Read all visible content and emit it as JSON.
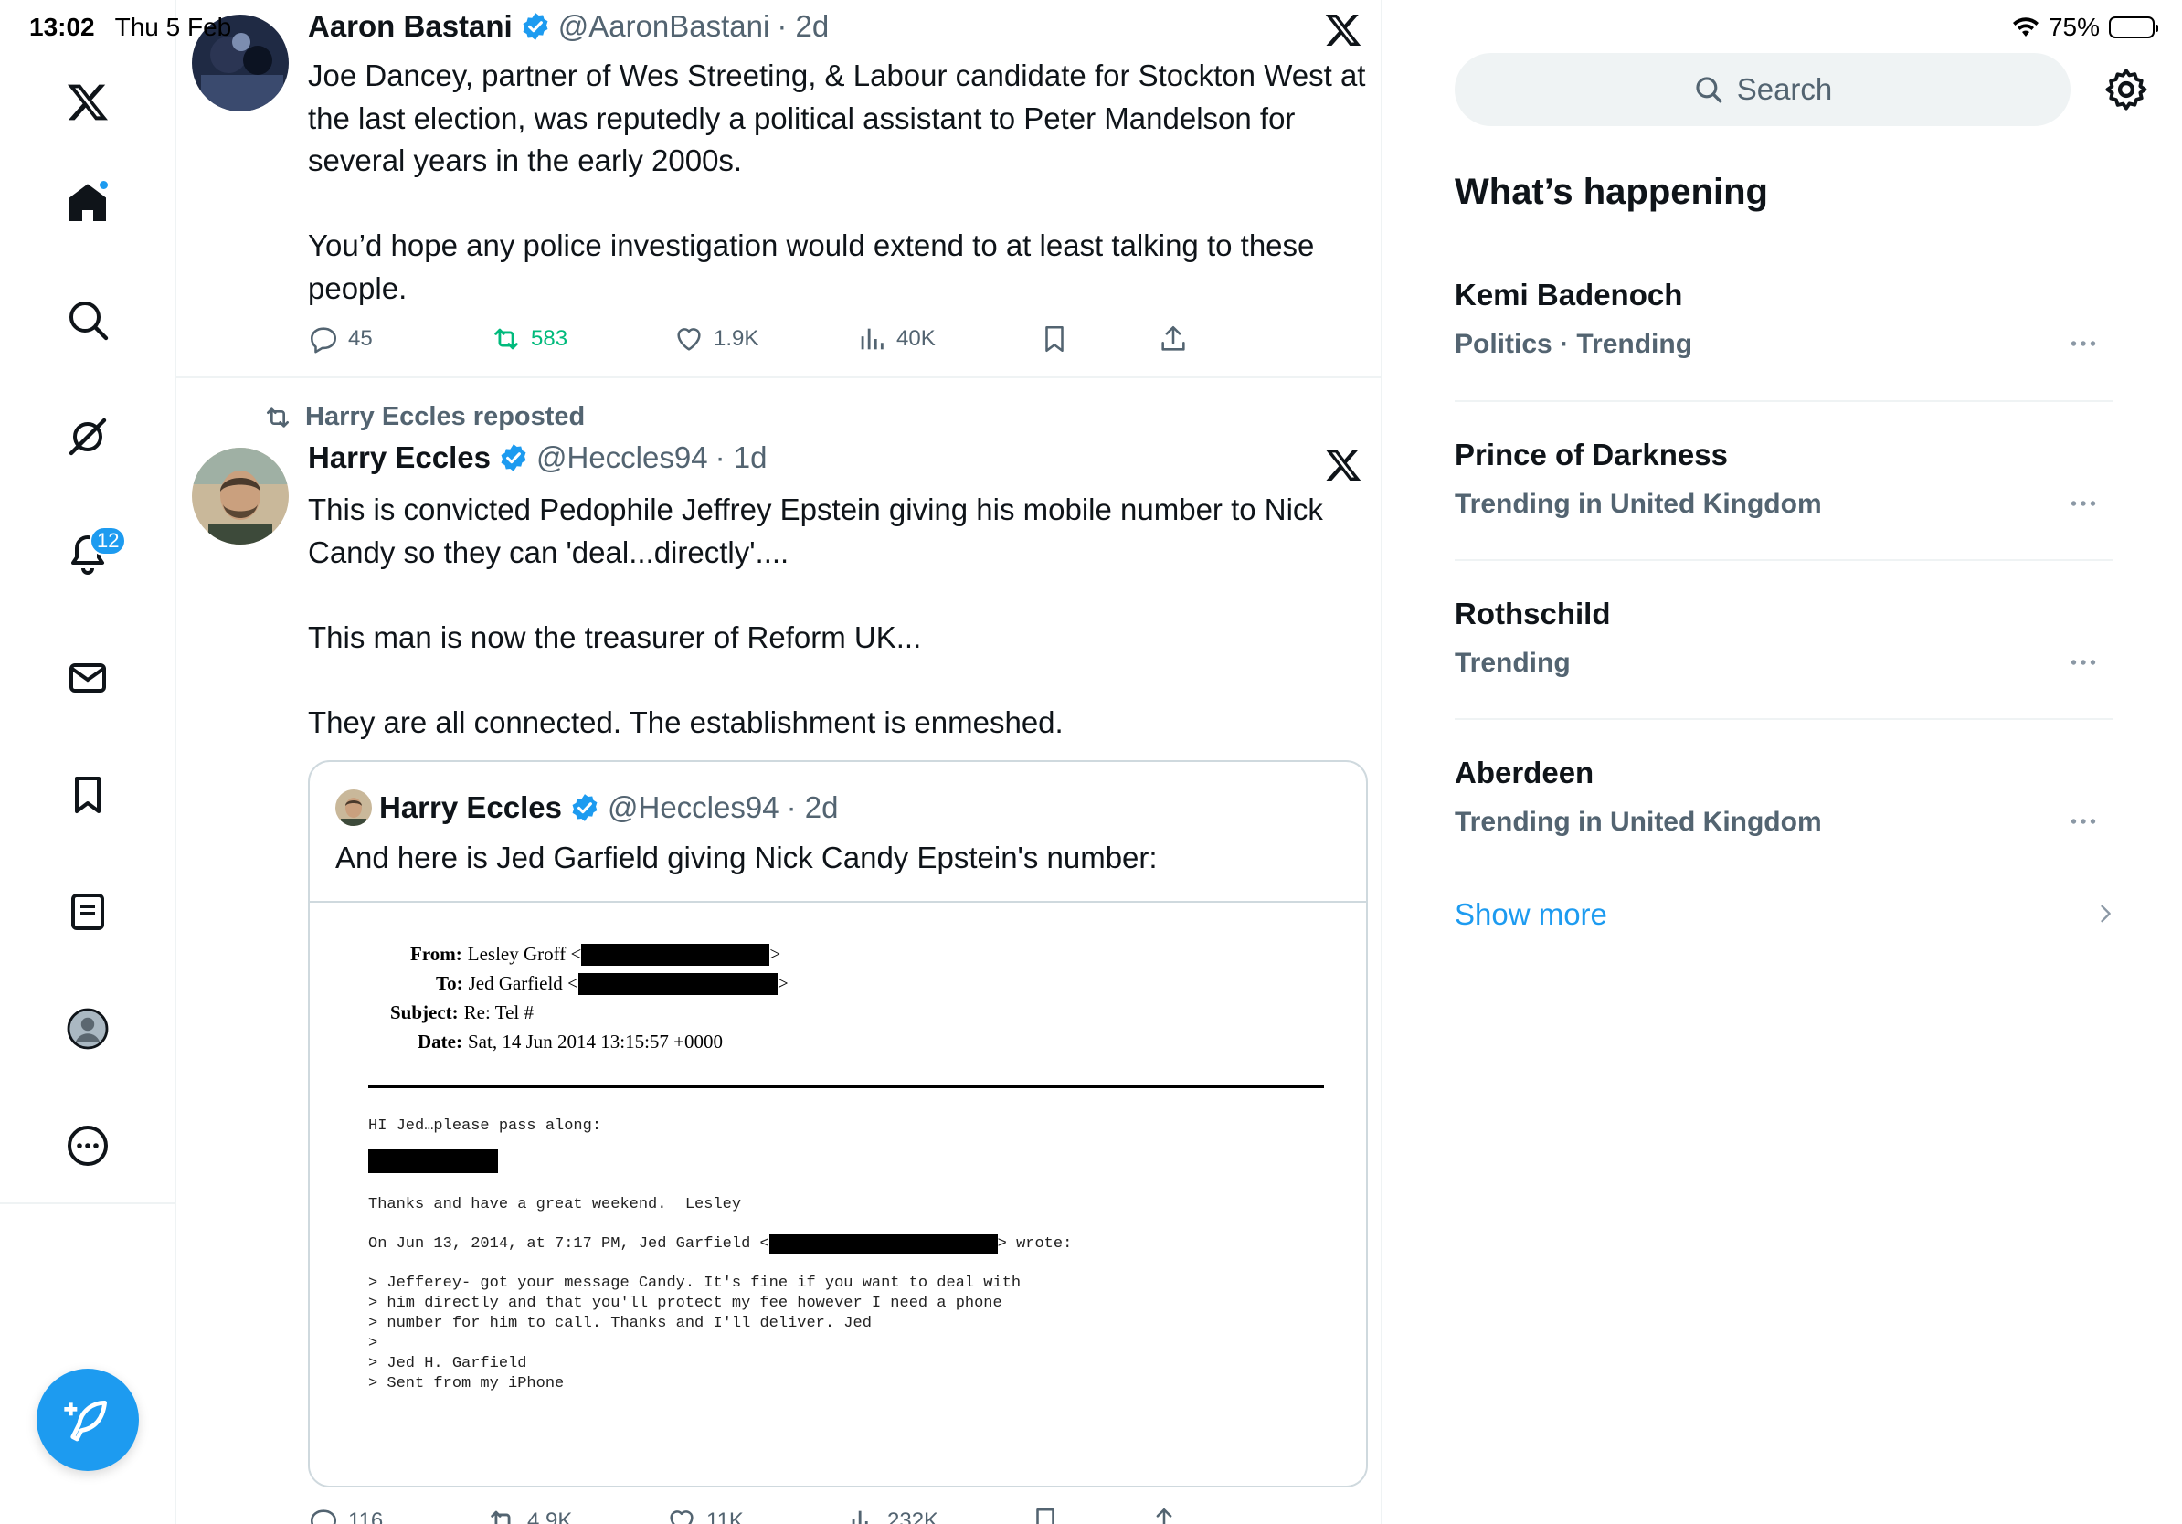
{
  "status_bar": {
    "time": "13:02",
    "date": "Thu 5 Feb",
    "battery": "75%"
  },
  "nav": {
    "items": [
      "x-logo-icon",
      "home-icon",
      "search-icon",
      "grok-icon",
      "notifications-icon",
      "messages-icon",
      "bookmarks-icon",
      "lists-icon",
      "profile-icon",
      "more-icon"
    ],
    "notifications_badge": "12"
  },
  "feed": {
    "tweet1": {
      "name": "Aaron Bastani",
      "handle": "@AaronBastani",
      "time": "· 2d",
      "text": "Joe Dancey, partner of Wes Streeting, & Labour candidate for Stockton West at the last election, was reputedly a political assistant to Peter Mandelson for several years in the early 2000s.\n\nYou’d hope any police investigation would extend to at least talking to these people.",
      "replies": "45",
      "reposts": "583",
      "likes": "1.9K",
      "views": "40K"
    },
    "tweet2": {
      "reposted_by": "Harry Eccles reposted",
      "name": "Harry Eccles",
      "handle": "@Heccles94",
      "time": "· 1d",
      "text": "This is convicted Pedophile Jeffrey Epstein giving his mobile number to Nick Candy so they can 'deal...directly'....\n\nThis man is now the treasurer of Reform UK...\n\nThey are all connected. The establishment is enmeshed.",
      "quote": {
        "name": "Harry Eccles",
        "handle": "@Heccles94",
        "time": "· 2d",
        "text": "And here is Jed Garfield giving Nick Candy Epstein's number:",
        "email": {
          "from_label": "From:",
          "from_value": "Lesley Groff <",
          "to_label": "To:",
          "to_value": "Jed Garfield <",
          "subject_label": "Subject:",
          "subject_value": "Re: Tel #",
          "date_label": "Date:",
          "date_value": "Sat, 14 Jun 2014 13:15:57 +0000",
          "line1": "HI Jed…please pass along:",
          "line2": "Thanks and have a great weekend.  Lesley",
          "line3_a": "On Jun 13, 2014, at 7:17 PM, Jed Garfield <",
          "line3_b": "> wrote:",
          "quoted": "> Jefferey- got your message Candy. It's fine if you want to deal with\n> him directly and that you'll protect my fee however I need a phone\n> number for him to call. Thanks and I'll deliver. Jed\n>\n> Jed H. Garfield\n> Sent from my iPhone"
        }
      },
      "replies": "116",
      "reposts": "4.9K",
      "likes": "11K",
      "views": "232K"
    }
  },
  "sidebar": {
    "search_placeholder": "Search",
    "section_title": "What’s happening",
    "trends": [
      {
        "name": "Kemi Badenoch",
        "meta": "Politics · Trending"
      },
      {
        "name": "Prince of Darkness",
        "meta": "Trending in United Kingdom"
      },
      {
        "name": "Rothschild",
        "meta": "Trending"
      },
      {
        "name": "Aberdeen",
        "meta": "Trending in United Kingdom"
      }
    ],
    "show_more": "Show more"
  },
  "colors": {
    "accent": "#1d9bf0",
    "text": "#0f1419",
    "muted": "#536471",
    "repost_green": "#00ba7c",
    "border": "#eff3f4"
  }
}
